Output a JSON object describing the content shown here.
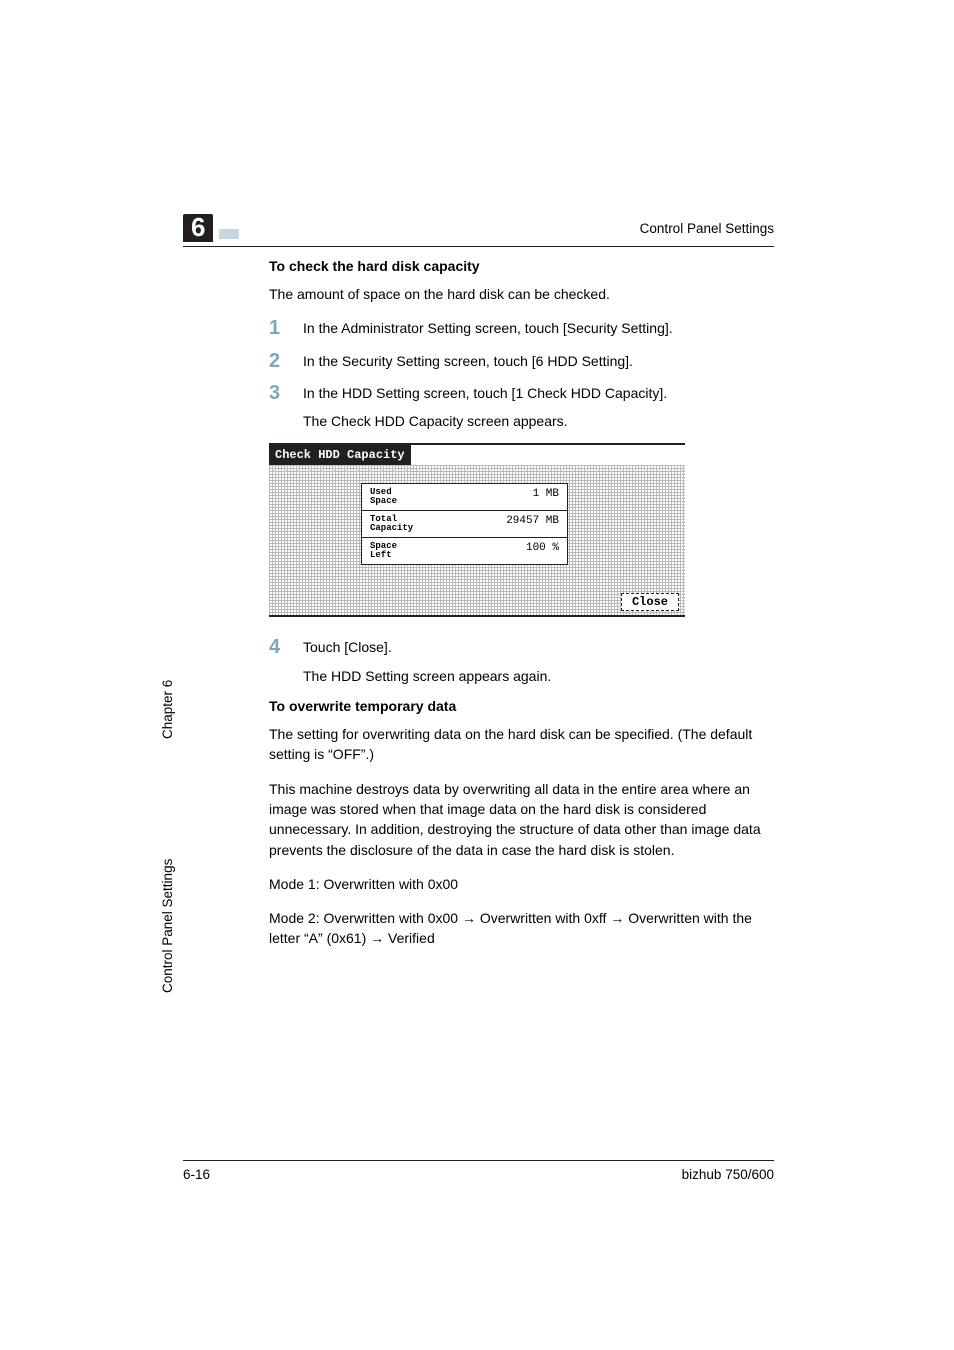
{
  "header": {
    "section_number": "6",
    "running_title": "Control Panel Settings"
  },
  "sections": {
    "check_capacity": {
      "heading": "To check the hard disk capacity",
      "intro": "The amount of space on the hard disk can be checked.",
      "steps": {
        "s1": "In the Administrator Setting screen, touch [Security Setting].",
        "s2": "In the Security Setting screen, touch [6 HDD Setting].",
        "s3": "In the HDD Setting screen, touch [1 Check HDD Capacity].",
        "s3_sub": "The Check HDD Capacity screen appears.",
        "s4": "Touch [Close].",
        "s4_sub": "The HDD Setting screen appears again."
      }
    },
    "overwrite": {
      "heading": "To overwrite temporary data",
      "p1": "The setting for overwriting data on the hard disk can be specified. (The default setting is “OFF”.)",
      "p2": "This machine destroys data by overwriting all data in the entire area where an image was stored when that image data on the hard disk is considered unnecessary. In addition, destroying the structure of data other than image data prevents the disclosure of the data in case the hard disk is stolen.",
      "mode1": "Mode 1: Overwritten with 0x00",
      "mode2": "Mode 2: Overwritten with 0x00 → Overwritten with 0xff → Overwritten with the letter “A” (0x61) → Verified"
    }
  },
  "device": {
    "title": "Check HDD Capacity",
    "rows": {
      "used_label": "Used\nSpace",
      "used_value": "1 MB",
      "total_label": "Total\nCapacity",
      "total_value": "29457 MB",
      "left_label": "Space\nLeft",
      "left_value": "100 %"
    },
    "close_label": "Close"
  },
  "side": {
    "chapter": "Chapter 6",
    "title": "Control Panel Settings"
  },
  "footer": {
    "page": "6-16",
    "product": "bizhub 750/600"
  },
  "chart_data": {
    "type": "table",
    "title": "Check HDD Capacity",
    "rows": [
      {
        "label": "Used Space",
        "value": 1,
        "unit": "MB"
      },
      {
        "label": "Total Capacity",
        "value": 29457,
        "unit": "MB"
      },
      {
        "label": "Space Left",
        "value": 100,
        "unit": "%"
      }
    ]
  }
}
